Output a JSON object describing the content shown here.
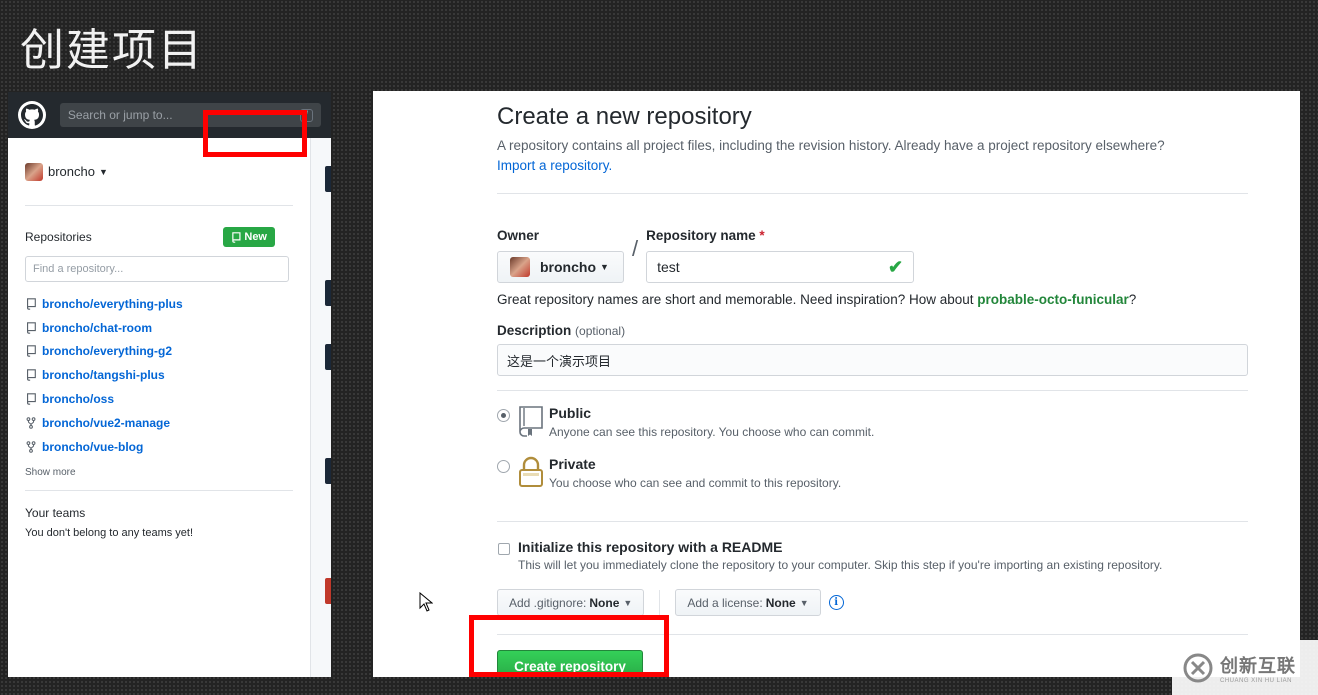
{
  "slide": {
    "title": "创建项目"
  },
  "dashboard": {
    "search_placeholder": "Search or jump to...",
    "search_shortcut": "/",
    "username": "broncho",
    "repositories_label": "Repositories",
    "new_button": "New",
    "find_placeholder": "Find a repository...",
    "repos": [
      {
        "name": "broncho/everything-plus",
        "icon": "repo-icon"
      },
      {
        "name": "broncho/chat-room",
        "icon": "repo-icon"
      },
      {
        "name": "broncho/everything-g2",
        "icon": "repo-icon"
      },
      {
        "name": "broncho/tangshi-plus",
        "icon": "repo-icon"
      },
      {
        "name": "broncho/oss",
        "icon": "repo-icon"
      },
      {
        "name": "broncho/vue2-manage",
        "icon": "fork-icon"
      },
      {
        "name": "broncho/vue-blog",
        "icon": "fork-icon"
      }
    ],
    "show_more": "Show more",
    "teams_title": "Your teams",
    "teams_text": "You don't belong to any teams yet!"
  },
  "form": {
    "title": "Create a new repository",
    "subtitle": "A repository contains all project files, including the revision history. Already have a project repository elsewhere?",
    "import_link": "Import a repository.",
    "owner_label": "Owner",
    "owner_value": "broncho",
    "name_label": "Repository name",
    "required_mark": "*",
    "name_value": "test",
    "hint_prefix": "Great repository names are short and memorable. Need inspiration? How about ",
    "hint_suggestion": "probable-octo-funicular",
    "hint_suffix": "?",
    "description_label": "Description",
    "description_optional": "(optional)",
    "description_value": "这是一个演示项目",
    "visibility": {
      "selected": "Public",
      "public_title": "Public",
      "public_desc": "Anyone can see this repository. You choose who can commit.",
      "private_title": "Private",
      "private_desc": "You choose who can see and commit to this repository."
    },
    "init_readme": {
      "checked": false,
      "title": "Initialize this repository with a README",
      "desc": "This will let you immediately clone the repository to your computer. Skip this step if you're importing an existing repository."
    },
    "gitignore_label": "Add .gitignore:",
    "gitignore_value": "None",
    "license_label": "Add a license:",
    "license_value": "None",
    "info_glyph": "i",
    "create_button": "Create repository"
  },
  "watermark": {
    "main": "创新互联",
    "sub": "CHUANG XIN HU LIAN"
  },
  "colors": {
    "primary_green": "#28a745",
    "link_blue": "#0366d6",
    "highlight_red": "#ff0000",
    "header_dark": "#24292e"
  }
}
